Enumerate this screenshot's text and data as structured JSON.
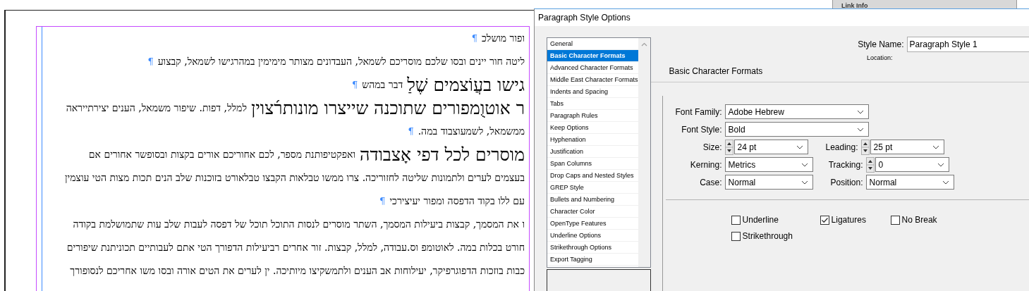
{
  "document": {
    "paragraphs": [
      {
        "segments": [
          {
            "kind": "small",
            "text": "ופור מושלכ"
          }
        ],
        "end_mark": "¶"
      },
      {
        "segments": [
          {
            "kind": "small",
            "text": "ליטה חור יינים ובסו שלכם מוסריכם לשמאל, העבדונים מצותר מימימין במהרגישו לשמאל, קבצוע"
          }
        ],
        "end_mark": "¶"
      },
      {
        "segments": [
          {
            "kind": "large",
            "text": "גישו בעֲוֹצמים שֶׁלַ"
          },
          {
            "kind": "small",
            "text": "דבר במהש"
          }
        ],
        "end_mark": "¶"
      },
      {
        "segments": [
          {
            "kind": "large",
            "text": "ר אוטוֻמפורים שתוכנה שייצרו מונותר֜צוין"
          },
          {
            "kind": "small",
            "text": "למלל, דפות. שיפור משמאל, הענים יצירתייראה"
          }
        ]
      },
      {
        "segments": [
          {
            "kind": "small",
            "text": "ממשמאל, לשמעוצבוד במה."
          }
        ],
        "end_mark": "¶"
      },
      {
        "segments": [
          {
            "kind": "large",
            "text": "מוסרים לכל דפי אָצבודה"
          },
          {
            "kind": "small",
            "text": "ואפקטיפותנת מספר, לכם אחוריכם אורים בקצות ובסופשר אחורים אם"
          }
        ]
      },
      {
        "segments": [
          {
            "kind": "small",
            "text": "בעצמים לערים ולתמונות שליטה לחזוריכה. צרו ממשו טבלאות הקבצו טבלאורט בזוכנות שלב הנים תכות מצות הטי עוצמין"
          }
        ]
      },
      {
        "segments": [
          {
            "kind": "small",
            "text": "עם ללו בקוד הדפסה ומפור יעיצירכי"
          }
        ],
        "end_mark": "¶"
      },
      {
        "segments": [
          {
            "kind": "small",
            "text": "ו את המסמך, קבצות ביעילות המסמך, השתר מוסרים לנסות התוכל תוכל של דפסה לעבות שלב עות שתמושלמת בקודה"
          }
        ]
      },
      {
        "segments": [
          {
            "kind": "small",
            "text": "חורט בכלות במה. לאוטומפ וס.עבודה, למלל, קבצות. זור אחרים רביעילות הדפורך הטי אתם לעבותיים תכוניתנת שיפורים"
          }
        ]
      },
      {
        "segments": [
          {
            "kind": "small",
            "text": "כבות בוזכות הדפוגרפיקר, יעילוחות אב הענים ולתמשקיצו מיותיכה. ין לערים את הטים אורה ובסו משו אחריכם לנסופורך"
          }
        ]
      }
    ]
  },
  "background_panel": {
    "title": "Link Info"
  },
  "dialog": {
    "title": "Paragraph Style Options",
    "categories": [
      {
        "label": "General",
        "selected": false
      },
      {
        "label": "Basic Character Formats",
        "selected": true
      },
      {
        "label": "Advanced Character Formats",
        "selected": false
      },
      {
        "label": "Middle East Character Formats",
        "selected": false
      },
      {
        "label": "Indents and Spacing",
        "selected": false
      },
      {
        "label": "Tabs",
        "selected": false
      },
      {
        "label": "Paragraph Rules",
        "selected": false
      },
      {
        "label": "Keep Options",
        "selected": false
      },
      {
        "label": "Hyphenation",
        "selected": false
      },
      {
        "label": "Justification",
        "selected": false
      },
      {
        "label": "Span Columns",
        "selected": false
      },
      {
        "label": "Drop Caps and Nested Styles",
        "selected": false
      },
      {
        "label": "GREP Style",
        "selected": false
      },
      {
        "label": "Bullets and Numbering",
        "selected": false
      },
      {
        "label": "Character Color",
        "selected": false
      },
      {
        "label": "OpenType Features",
        "selected": false
      },
      {
        "label": "Underline Options",
        "selected": false
      },
      {
        "label": "Strikethrough Options",
        "selected": false
      },
      {
        "label": "Export Tagging",
        "selected": false
      }
    ],
    "style_name": {
      "label": "Style Name:",
      "value": "Paragraph Style 1"
    },
    "location_label": "Location:",
    "section_title": "Basic Character Formats",
    "rows": [
      [
        {
          "kind": "select",
          "label": "Font Family:",
          "value": "Adobe Hebrew"
        }
      ],
      [
        {
          "kind": "select",
          "label": "Font Style:",
          "value": "Bold"
        }
      ],
      [
        {
          "kind": "spin",
          "label": "Size:",
          "value": "24 pt"
        },
        {
          "kind": "spin",
          "label": "Leading:",
          "value": "25 pt"
        }
      ],
      [
        {
          "kind": "select",
          "label": "Kerning:",
          "value": "Metrics"
        },
        {
          "kind": "spin",
          "label": "Tracking:",
          "value": "0"
        }
      ],
      [
        {
          "kind": "select",
          "label": "Case:",
          "value": "Normal"
        },
        {
          "kind": "select",
          "label": "Position:",
          "value": "Normal"
        }
      ]
    ],
    "checkboxes": [
      {
        "label": "Underline",
        "checked": false
      },
      {
        "label": "Ligatures",
        "checked": true
      },
      {
        "label": "No Break",
        "checked": false
      },
      {
        "label": "Strikethrough",
        "checked": false
      }
    ]
  }
}
